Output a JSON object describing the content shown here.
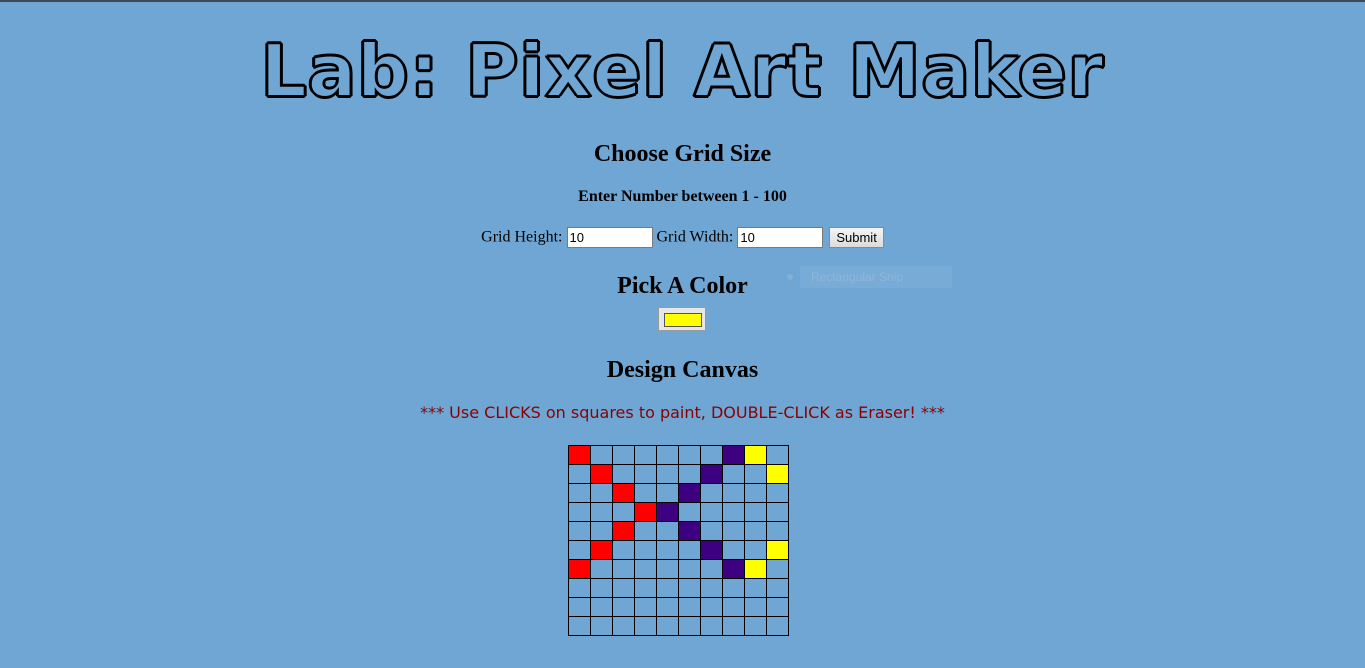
{
  "header": {
    "title": "Lab: Pixel Art Maker"
  },
  "grid_size": {
    "heading": "Choose Grid Size",
    "instruction": "Enter Number between 1 - 100",
    "height_label": "Grid Height:",
    "height_value": "10",
    "width_label": "Grid Width:",
    "width_value": "10",
    "submit_label": "Submit"
  },
  "color": {
    "heading": "Pick A Color",
    "selected": "#ffff00"
  },
  "snip_overlay": {
    "label": "Rectangular Snip"
  },
  "canvas": {
    "heading": "Design Canvas",
    "instructions": "*** Use CLICKS on squares to paint, DOUBLE-CLICK as Eraser! ***",
    "rows": 10,
    "cols": 10,
    "colors": {
      "R": "#ff0000",
      "P": "#3d0080",
      "Y": "#ffff00"
    },
    "cells": [
      "R......PY.",
      ".R....P..Y",
      "..R..P....",
      "...RP.....",
      "..R..P....",
      ".R....P..Y",
      "R......PY.",
      "..........",
      "..........",
      ".........."
    ]
  }
}
